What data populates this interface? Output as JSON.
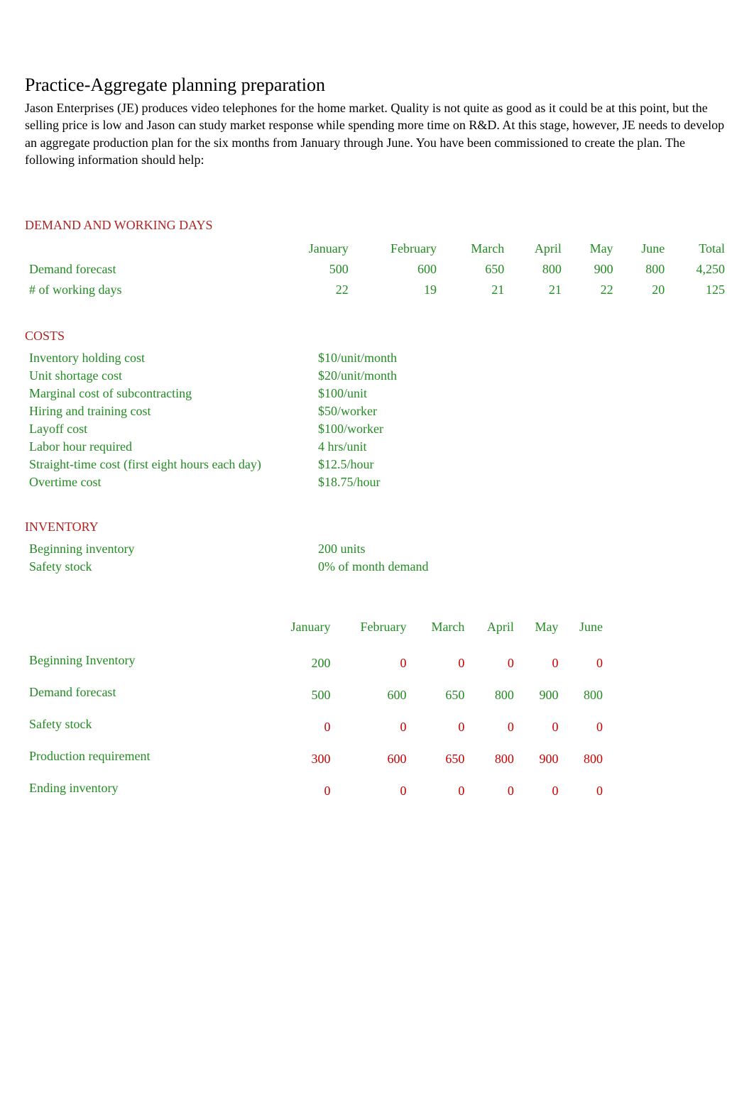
{
  "title": "Practice-Aggregate planning preparation",
  "intro": "Jason Enterprises (JE) produces video telephones for the home market. Quality is not quite as good as it could be at this point, but the selling price is low and Jason can study market response while spending more time on R&D. At this stage, however, JE needs to develop an aggregate production plan for the six months from January through June. You have been commissioned to create the plan. The following information should help:",
  "sections": {
    "demand_header": "DEMAND AND WORKING DAYS",
    "costs_header": "COSTS",
    "inventory_header": "INVENTORY"
  },
  "months": [
    "January",
    "February",
    "March",
    "April",
    "May",
    "June"
  ],
  "total_label": "Total",
  "demand_table": {
    "rows": [
      {
        "label": "Demand forecast",
        "values": [
          "500",
          "600",
          "650",
          "800",
          "900",
          "800"
        ],
        "total": "4,250"
      },
      {
        "label": "# of working days",
        "values": [
          "22",
          "19",
          "21",
          "21",
          "22",
          "20"
        ],
        "total": "125"
      }
    ]
  },
  "costs": [
    {
      "label": "Inventory holding cost",
      "value": "$10/unit/month"
    },
    {
      "label": "Unit shortage cost",
      "value": "$20/unit/month"
    },
    {
      "label": "Marginal cost of subcontracting",
      "value": "$100/unit"
    },
    {
      "label": "Hiring and training cost",
      "value": "$50/worker"
    },
    {
      "label": "Layoff cost",
      "value": "$100/worker"
    },
    {
      "label": "Labor hour required",
      "value": "4 hrs/unit"
    },
    {
      "label": "Straight-time cost (first eight hours each day)",
      "value": "$12.5/hour"
    },
    {
      "label": "Overtime cost",
      "value": "$18.75/hour"
    }
  ],
  "inventory": [
    {
      "label": "Beginning inventory",
      "value": "200 units"
    },
    {
      "label": "Safety stock",
      "value": "0% of month demand"
    }
  ],
  "plan_table": {
    "rows": [
      {
        "label": "Beginning Inventory",
        "values": [
          "200",
          "0",
          "0",
          "0",
          "0",
          "0"
        ],
        "red_first": false
      },
      {
        "label": "Demand forecast",
        "values": [
          "500",
          "600",
          "650",
          "800",
          "900",
          "800"
        ],
        "red_first": false
      },
      {
        "label": "Safety stock",
        "values": [
          "0",
          "0",
          "0",
          "0",
          "0",
          "0"
        ],
        "red_first": false
      },
      {
        "label": "Production requirement",
        "values": [
          "300",
          "600",
          "650",
          "800",
          "900",
          "800"
        ],
        "red_first": true
      },
      {
        "label": "Ending inventory",
        "values": [
          "0",
          "0",
          "0",
          "0",
          "0",
          "0"
        ],
        "red_first": false
      }
    ]
  }
}
